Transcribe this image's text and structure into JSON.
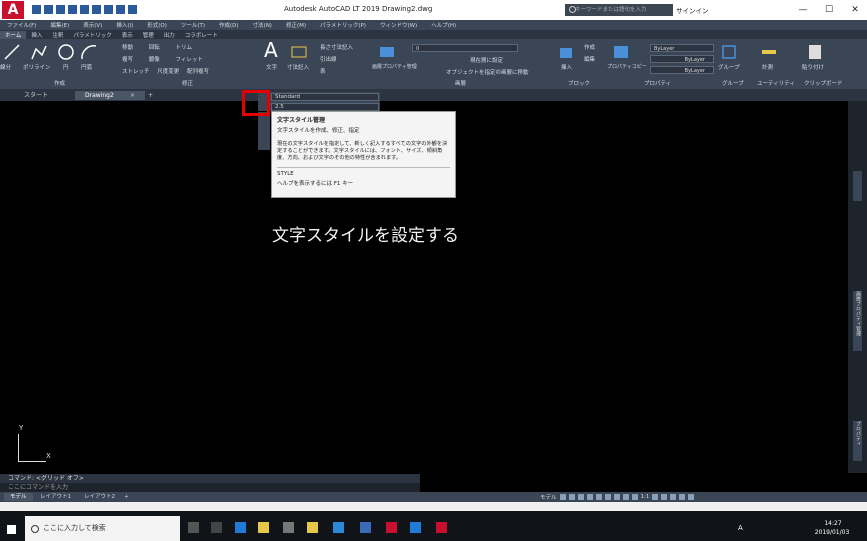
{
  "window": {
    "app_logo": "A",
    "app_logo_sub": "LT",
    "title": "Autodesk AutoCAD LT 2019    Drawing2.dwg",
    "search_placeholder": "キーワードまたは語句を入力",
    "signin_label": "サインイン",
    "minimize": "—",
    "maximize": "☐",
    "close": "✕"
  },
  "menubar": [
    "ファイル(F)",
    "編集(E)",
    "表示(V)",
    "挿入(I)",
    "形式(O)",
    "ツール(T)",
    "作成(D)",
    "寸法(N)",
    "修正(M)",
    "パラメトリック(P)",
    "ウィンドウ(W)",
    "ヘルプ(H)"
  ],
  "ribbon_tabs": [
    "ホーム",
    "挿入",
    "注釈",
    "パラメトリック",
    "表示",
    "管理",
    "出力",
    "コラボレート"
  ],
  "ribbon": {
    "draw": {
      "line": "線分",
      "polyline": "ポリライン",
      "circle": "円",
      "arc": "円弧",
      "panel": "作成"
    },
    "modify": {
      "row1": [
        "移動",
        "回転",
        "トリム"
      ],
      "row2": [
        "複写",
        "鏡像",
        "フィレット"
      ],
      "row3": [
        "ストレッチ",
        "尺度変更",
        "配列複写"
      ],
      "panel": "修正"
    },
    "annotation": {
      "text": "文字",
      "dimension": "寸法記入",
      "linear": "長さ寸法記入",
      "leader": "引出線",
      "table": "表"
    },
    "layers": {
      "props": "画層プロパティ管理",
      "current_layer": "0",
      "set_current": "現在層に設定",
      "match": "オブジェクトを指定の画層に移動",
      "panel": "画層"
    },
    "block": {
      "insert": "挿入",
      "create": "作成",
      "edit": "編集",
      "panel": "ブロック"
    },
    "properties": {
      "match": "プロパティコピー",
      "bylayer1": "ByLayer",
      "bylayer2": "ByLayer",
      "bylayer3": "ByLayer",
      "panel": "プロパティ"
    },
    "groups": {
      "group": "グループ",
      "panel": "グループ"
    },
    "utilities": {
      "measure": "計測",
      "panel": "ユーティリティ"
    },
    "clipboard": {
      "paste": "貼り付け",
      "panel": "クリップボード"
    }
  },
  "doc_tabs": {
    "start": "スタート",
    "drawing": "Drawing2",
    "close": "×",
    "add": "+"
  },
  "text_style": {
    "combo1": "Standard",
    "combo2": "2.5"
  },
  "tooltip": {
    "title": "文字スタイル管理",
    "subtitle": "文字スタイルを作成、修正、指定",
    "description": "現在の文字スタイルを指定して、新しく記入するすべての文字の外観を決定することができます。文字スタイルには、フォント、サイズ、傾斜角度、方向、および文字のその他の特性が含まれます。",
    "command": "STYLE",
    "help": "ヘルプを表示するには F1 キー"
  },
  "caption": "文字スタイルを設定する",
  "ucs": {
    "x": "X",
    "y": "Y"
  },
  "command": {
    "history": "コマンド: <グリッド オフ>",
    "placeholder": "ここにコマンドを入力"
  },
  "layout_tabs": [
    "モデル",
    "レイアウト1",
    "レイアウト2",
    "+"
  ],
  "status": {
    "model": "モデル",
    "scale": "1:1"
  },
  "right_panel": {
    "label": "画層プロパティ管理",
    "label2": "プロパティ"
  },
  "taskbar": {
    "search_placeholder": "ここに入力して検索",
    "time": "14:27",
    "date": "2019/01/03",
    "ime": "A"
  },
  "colors": {
    "accent": "#c8102e",
    "ribbon_bg": "#3a4555",
    "highlight": "#e50000"
  }
}
